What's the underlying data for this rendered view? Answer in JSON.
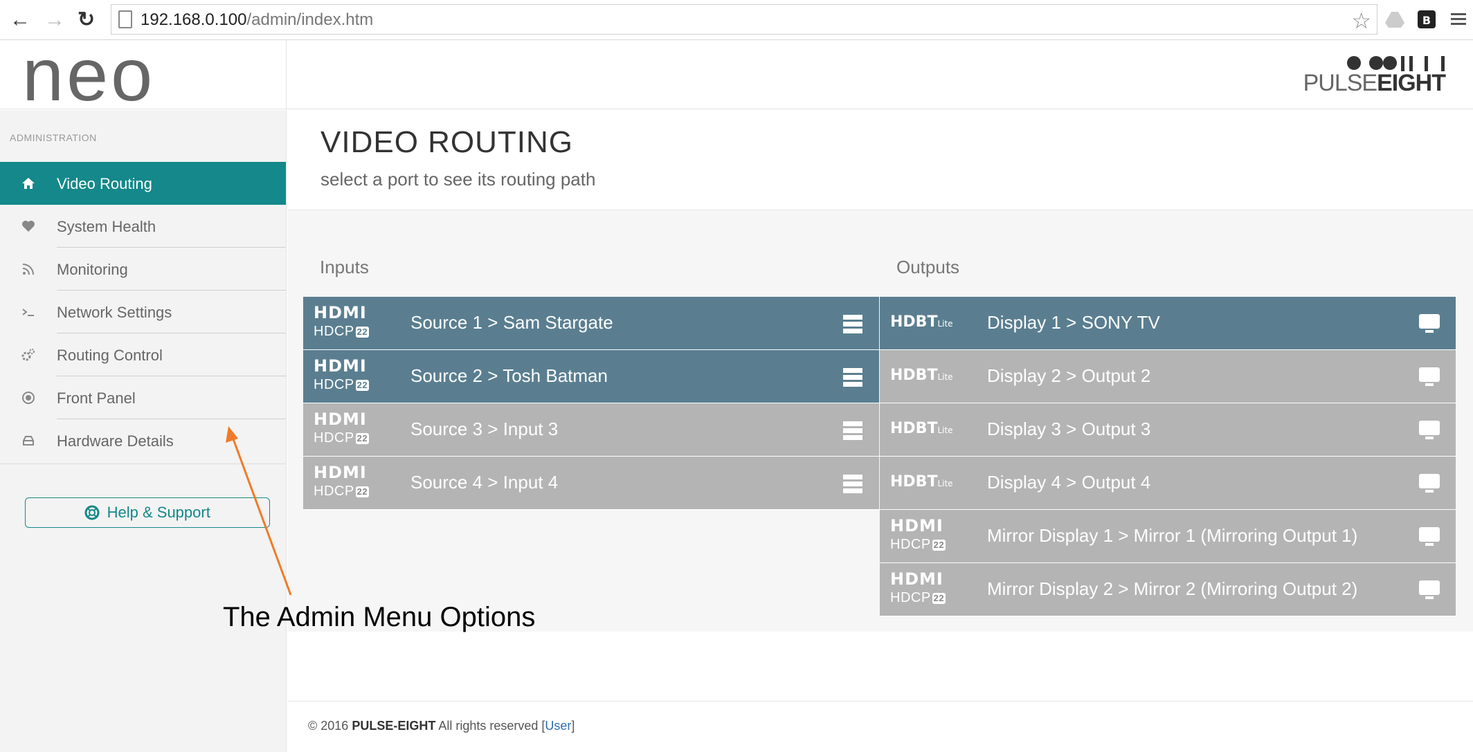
{
  "browser": {
    "url_host": "192.168.0.100",
    "url_path": "/admin/index.htm"
  },
  "header": {
    "logo": "neo",
    "brand_light": "PULSE",
    "brand_bold": "EIGHT"
  },
  "sidebar": {
    "heading": "ADMINISTRATION",
    "items": [
      {
        "label": "Video Routing",
        "icon": "home-icon"
      },
      {
        "label": "System Health",
        "icon": "heart-icon"
      },
      {
        "label": "Monitoring",
        "icon": "rss-icon"
      },
      {
        "label": "Network Settings",
        "icon": "terminal-icon"
      },
      {
        "label": "Routing Control",
        "icon": "cogs-icon"
      },
      {
        "label": "Front Panel",
        "icon": "target-icon"
      },
      {
        "label": "Hardware Details",
        "icon": "hdd-icon"
      }
    ],
    "help_label": "Help & Support"
  },
  "main": {
    "title": "VIDEO ROUTING",
    "subtitle": "select a port to see its routing path",
    "inputs_label": "Inputs",
    "outputs_label": "Outputs",
    "inputs": [
      {
        "badge_top": "HDMI",
        "badge_bottom": "HDCP",
        "badge_num": "22",
        "label": "Source 1 > Sam Stargate",
        "active": true
      },
      {
        "badge_top": "HDMI",
        "badge_bottom": "HDCP",
        "badge_num": "22",
        "label": "Source 2 > Tosh Batman",
        "active": true
      },
      {
        "badge_top": "HDMI",
        "badge_bottom": "HDCP",
        "badge_num": "22",
        "label": "Source 3 > Input 3",
        "active": false
      },
      {
        "badge_top": "HDMI",
        "badge_bottom": "HDCP",
        "badge_num": "22",
        "label": "Source 4 > Input 4",
        "active": false
      }
    ],
    "outputs": [
      {
        "type": "hdbt",
        "badge_top": "HDBT",
        "badge_lite": "Lite",
        "label": "Display 1 > SONY TV",
        "active": true
      },
      {
        "type": "hdbt",
        "badge_top": "HDBT",
        "badge_lite": "Lite",
        "label": "Display 2 > Output 2",
        "active": false
      },
      {
        "type": "hdbt",
        "badge_top": "HDBT",
        "badge_lite": "Lite",
        "label": "Display 3 > Output 3",
        "active": false
      },
      {
        "type": "hdbt",
        "badge_top": "HDBT",
        "badge_lite": "Lite",
        "label": "Display 4 > Output 4",
        "active": false
      },
      {
        "type": "hdmi",
        "badge_top": "HDMI",
        "badge_bottom": "HDCP",
        "badge_num": "22",
        "label": "Mirror Display 1 > Mirror 1 (Mirroring Output 1)",
        "active": false
      },
      {
        "type": "hdmi",
        "badge_top": "HDMI",
        "badge_bottom": "HDCP",
        "badge_num": "22",
        "label": "Mirror Display 2 > Mirror 2 (Mirroring Output 2)",
        "active": false
      }
    ]
  },
  "footer": {
    "copyright": "© 2016 ",
    "company": "PULSE-EIGHT",
    "rights": " All rights reserved [",
    "user": "User",
    "close": "]"
  },
  "annotation": "The Admin Menu Options",
  "colors": {
    "accent": "#14888a",
    "port_active": "#5a7e90",
    "port_inactive": "#b4b4b4",
    "arrow": "#f07a2a"
  }
}
